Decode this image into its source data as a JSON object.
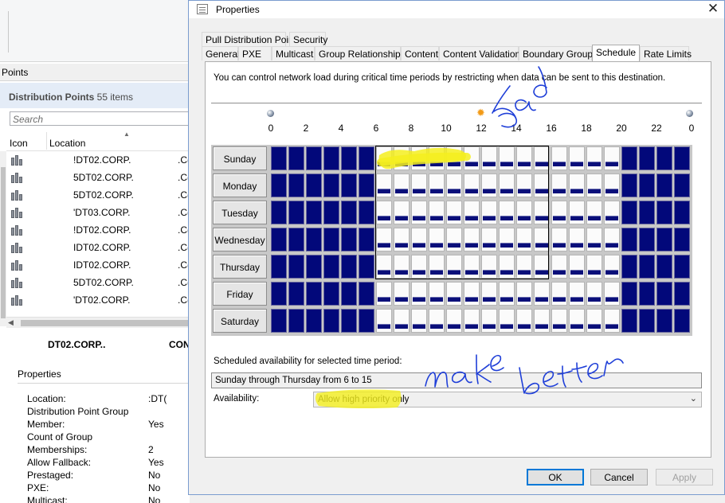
{
  "console": {
    "pane_title": "Points",
    "header_title": "Distribution Points",
    "header_count": "55 items",
    "search_placeholder": "Search",
    "columns": [
      "Icon",
      "Location"
    ],
    "rows": [
      {
        "name": "!DT02.CORP.",
        "suffix": ".C("
      },
      {
        "name": "5DT02.CORP.",
        "suffix": ".C("
      },
      {
        "name": "5DT02.CORP.",
        "suffix": ".C("
      },
      {
        "name": "'DT03.CORP.",
        "suffix": ".C("
      },
      {
        "name": "!DT02.CORP.",
        "suffix": ".C("
      },
      {
        "name": "IDT02.CORP.",
        "suffix": ".C("
      },
      {
        "name": "IDT02.CORP.",
        "suffix": ".C("
      },
      {
        "name": "5DT02.CORP.",
        "suffix": ".C("
      },
      {
        "name": "'DT02.CORP.",
        "suffix": ".C("
      }
    ],
    "detail_name": "DT02.CORP..",
    "detail_name2": "CON",
    "properties_title": "Properties",
    "properties": [
      {
        "key": "Location:",
        "value": ":DT("
      },
      {
        "key": "Distribution Point Group",
        "value": ""
      },
      {
        "key": "Member:",
        "value": "Yes"
      },
      {
        "key": "Count of Group",
        "value": ""
      },
      {
        "key": "Memberships:",
        "value": "2"
      },
      {
        "key": "Allow Fallback:",
        "value": "Yes"
      },
      {
        "key": "Prestaged:",
        "value": "No"
      },
      {
        "key": "PXE:",
        "value": "No"
      },
      {
        "key": "Multicast:",
        "value": "No"
      }
    ]
  },
  "dialog": {
    "title": "Properties",
    "close_glyph": "✕",
    "tabs_row1": [
      "Pull Distribution Point",
      "Security"
    ],
    "tabs_row2": [
      "General",
      "PXE",
      "Multicast",
      "Group Relationships",
      "Content",
      "Content Validation",
      "Boundary Groups",
      "Schedule",
      "Rate Limits"
    ],
    "active_tab": "Schedule",
    "info_text": "You can control network load during critical time periods by restricting when data can be sent to this destination.",
    "hour_labels": [
      "0",
      "2",
      "4",
      "6",
      "8",
      "10",
      "12",
      "14",
      "16",
      "18",
      "20",
      "22",
      "0"
    ],
    "days": [
      "Sunday",
      "Monday",
      "Tuesday",
      "Wednesday",
      "Thursday",
      "Friday",
      "Saturday"
    ],
    "restricted_hours": {
      "start": 6,
      "end": 20
    },
    "selection": {
      "from_day": "Sunday",
      "to_day": "Thursday",
      "from_hour": 6,
      "to_hour": 15
    },
    "scheduled_label": "Scheduled availability for selected time period:",
    "scheduled_value": "Sunday through Thursday from 6 to 15",
    "availability_label": "Availability:",
    "availability_value": "Allow high priority only",
    "buttons": {
      "ok": "OK",
      "cancel": "Cancel",
      "apply": "Apply"
    }
  },
  "annotations": {
    "text1": "Bad",
    "text2": "make",
    "text3": "better",
    "ink_color": "#1f3fd8",
    "highlight_color": "#f4ef1e"
  }
}
